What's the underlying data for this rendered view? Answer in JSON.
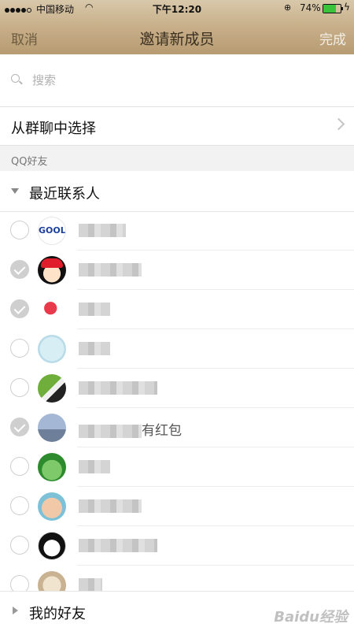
{
  "status_bar": {
    "carrier": "中国移动",
    "time": "下午12:20",
    "battery_percent": "74%",
    "battery_level": 0.74
  },
  "nav": {
    "cancel": "取消",
    "title": "邀请新成员",
    "done": "完成"
  },
  "search": {
    "placeholder": "搜索"
  },
  "group_select": {
    "label": "从群聊中选择"
  },
  "section_header": "QQ好友",
  "recent_contacts": {
    "label": "最近联系人",
    "contacts": [
      {
        "checked": false,
        "avatar": "gool-logo",
        "avatar_text": "GOOL",
        "name": "",
        "name_blur": 60
      },
      {
        "checked": true,
        "avatar": "girl-red-cap",
        "name": "",
        "name_blur": 80
      },
      {
        "checked": true,
        "avatar": "red-lips",
        "name": "",
        "name_blur": 40
      },
      {
        "checked": false,
        "avatar": "winter-drawing",
        "name": "",
        "name_blur": 40
      },
      {
        "checked": false,
        "avatar": "penguin",
        "name": "",
        "name_blur": 100
      },
      {
        "checked": true,
        "avatar": "sea-photo",
        "name": "有红包",
        "name_blur": 80
      },
      {
        "checked": false,
        "avatar": "cartoon-kid",
        "name": "",
        "name_blur": 40
      },
      {
        "checked": false,
        "avatar": "baby-face",
        "name": "",
        "name_blur": 80
      },
      {
        "checked": false,
        "avatar": "chibi-girl",
        "name": "",
        "name_blur": 100
      },
      {
        "checked": false,
        "avatar": "dog-photo",
        "name": "",
        "name_blur": 30
      }
    ]
  },
  "my_friends": {
    "label": "我的好友"
  },
  "watermark": "Baidu经验"
}
